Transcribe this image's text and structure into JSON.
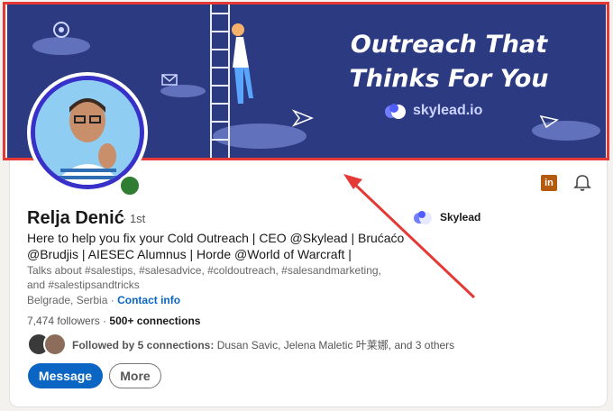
{
  "banner": {
    "title_line1": "Outreach That",
    "title_line2": "Thinks For You",
    "brand": "skylead.io"
  },
  "profile": {
    "name": "Relja Denić",
    "degree": "· 1st",
    "headline": "Here to help you fix your Cold Outreach | CEO @Skylead | Brućaćo @Brudjis | AIESEC Alumnus | Horde @World of Warcraft |",
    "talks_about": "Talks about #salestips, #salesadvice, #coldoutreach, #salesandmarketing, and #salestipsandtricks",
    "location": "Belgrade, Serbia ·",
    "contact_info": "Contact info",
    "followers": "7,474 followers",
    "connections": "500+ connections",
    "followed_by_label": "Followed by 5 connections:",
    "followed_by_names": "Dusan Savic, Jelena Maletic 叶莱娜, and 3 others"
  },
  "company": {
    "name": "Skylead"
  },
  "actions": {
    "message": "Message",
    "more": "More"
  },
  "icons": {
    "linkedin": "in"
  },
  "colors": {
    "banner": "#2c3a82",
    "accent": "#0a66c2",
    "highlight": "#e53935"
  }
}
